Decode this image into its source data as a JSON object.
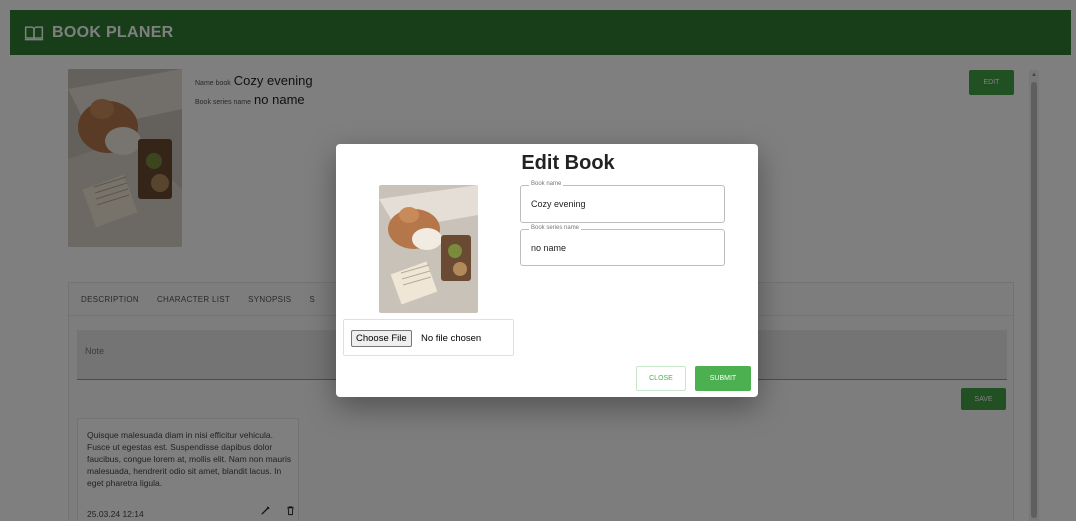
{
  "app": {
    "title": "BOOK PLANER",
    "icon": "book-open-icon"
  },
  "book": {
    "name_label": "Name book",
    "name": "Cozy evening",
    "series_label": "Book series name",
    "series": "no name"
  },
  "header": {
    "edit_label": "EDIT"
  },
  "tabs": [
    {
      "label": "DESCRIPTION"
    },
    {
      "label": "CHARACTER LIST"
    },
    {
      "label": "SYNOPSIS"
    },
    {
      "label": "S"
    }
  ],
  "note": {
    "placeholder": "Note",
    "save_label": "SAVE"
  },
  "notes": [
    {
      "text": "Quisque malesuada diam in nisi efficitur vehicula. Fusce ut egestas est. Suspendisse dapibus dolor faucibus, congue lorem at, mollis elit. Nam non mauris malesuada, hendrerit odio sit amet, blandit lacus. In eget pharetra ligula.",
      "date": "25.03.24 12:14"
    }
  ],
  "dialog": {
    "title": "Edit Book",
    "book_name_label": "Book name",
    "book_name_value": "Cozy evening",
    "series_label": "Book series name",
    "series_value": "no name",
    "choose_file_label": "Choose File",
    "file_status": "No file chosen",
    "close_label": "CLOSE",
    "submit_label": "SUBMIT"
  },
  "colors": {
    "appbar": "#2e7d32",
    "accent": "#43a047",
    "submit": "#4caf50"
  }
}
